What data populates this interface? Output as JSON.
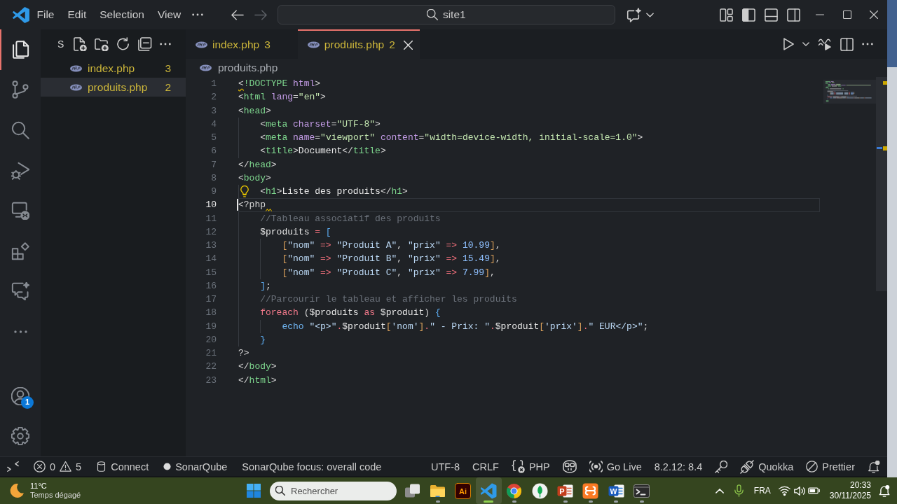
{
  "title_bar": {
    "menus": [
      "File",
      "Edit",
      "Selection",
      "View"
    ],
    "nav": [
      {
        "kind": "back",
        "disabled": false
      },
      {
        "kind": "forward",
        "disabled": true
      }
    ],
    "command_center": "site1",
    "layout_toggles": [
      {
        "kind": "primary-sidebar",
        "on": true
      },
      {
        "kind": "panel",
        "on": false
      },
      {
        "kind": "secondary-sidebar",
        "on": false
      }
    ]
  },
  "activity_bar": {
    "items": [
      {
        "kind": "explorer",
        "selected": true
      },
      {
        "kind": "source-control",
        "selected": false
      },
      {
        "kind": "search",
        "selected": false
      },
      {
        "kind": "run-debug",
        "selected": false
      },
      {
        "kind": "remote",
        "selected": false
      },
      {
        "kind": "extensions",
        "selected": false
      },
      {
        "kind": "chat",
        "selected": false
      }
    ],
    "accounts_badge": "1"
  },
  "sidebar": {
    "title": "S",
    "files": [
      {
        "name": "index.php",
        "problems": "3",
        "warning": true,
        "selected": false
      },
      {
        "name": "produits.php",
        "problems": "2",
        "warning": true,
        "selected": true
      }
    ]
  },
  "tabs": [
    {
      "name": "index.php",
      "problems": "3",
      "warning": true,
      "selected": false
    },
    {
      "name": "produits.php",
      "problems": "2",
      "warning": true,
      "selected": true
    }
  ],
  "breadcrumb": "produits.php",
  "editor": {
    "lines": [
      {
        "number": "1",
        "current": false,
        "lightbulb": false,
        "tokens": [
          {
            "kind": "warn",
            "text": "<"
          },
          {
            "kind": "tag",
            "text": "!DOCTYPE"
          },
          {
            "kind": "attr",
            "text": " html"
          },
          {
            "kind": "plain",
            "text": ">"
          }
        ]
      },
      {
        "number": "2",
        "current": false,
        "lightbulb": false,
        "tokens": [
          {
            "kind": "plain",
            "text": "<"
          },
          {
            "kind": "tag",
            "text": "html"
          },
          {
            "kind": "attr",
            "text": " lang"
          },
          {
            "kind": "plain",
            "text": "="
          },
          {
            "kind": "val",
            "text": "\"en\""
          },
          {
            "kind": "plain",
            "text": ">"
          }
        ]
      },
      {
        "number": "3",
        "current": false,
        "lightbulb": false,
        "tokens": [
          {
            "kind": "plain",
            "text": "<"
          },
          {
            "kind": "tag",
            "text": "head"
          },
          {
            "kind": "plain",
            "text": ">"
          }
        ]
      },
      {
        "number": "4",
        "current": false,
        "lightbulb": false,
        "tokens": [
          {
            "kind": "plain",
            "text": "    <"
          },
          {
            "kind": "tag",
            "text": "meta"
          },
          {
            "kind": "attr",
            "text": " charset"
          },
          {
            "kind": "plain",
            "text": "="
          },
          {
            "kind": "val",
            "text": "\"UTF-8\""
          },
          {
            "kind": "plain",
            "text": ">"
          }
        ]
      },
      {
        "number": "5",
        "current": false,
        "lightbulb": false,
        "tokens": [
          {
            "kind": "plain",
            "text": "    <"
          },
          {
            "kind": "tag",
            "text": "meta"
          },
          {
            "kind": "attr",
            "text": " name"
          },
          {
            "kind": "plain",
            "text": "="
          },
          {
            "kind": "val",
            "text": "\"viewport\""
          },
          {
            "kind": "attr",
            "text": " content"
          },
          {
            "kind": "plain",
            "text": "="
          },
          {
            "kind": "val",
            "text": "\"width=device-width, initial-scale=1.0\""
          },
          {
            "kind": "plain",
            "text": ">"
          }
        ]
      },
      {
        "number": "6",
        "current": false,
        "lightbulb": false,
        "tokens": [
          {
            "kind": "plain",
            "text": "    <"
          },
          {
            "kind": "tag",
            "text": "title"
          },
          {
            "kind": "plain",
            "text": ">"
          },
          {
            "kind": "text",
            "text": "Document"
          },
          {
            "kind": "plain",
            "text": "</"
          },
          {
            "kind": "tag",
            "text": "title"
          },
          {
            "kind": "plain",
            "text": ">"
          }
        ]
      },
      {
        "number": "7",
        "current": false,
        "lightbulb": false,
        "tokens": [
          {
            "kind": "plain",
            "text": "</"
          },
          {
            "kind": "tag",
            "text": "head"
          },
          {
            "kind": "plain",
            "text": ">"
          }
        ]
      },
      {
        "number": "8",
        "current": false,
        "lightbulb": false,
        "tokens": [
          {
            "kind": "plain",
            "text": "<"
          },
          {
            "kind": "tag",
            "text": "body"
          },
          {
            "kind": "plain",
            "text": ">"
          }
        ]
      },
      {
        "number": "9",
        "current": false,
        "lightbulb": true,
        "tokens": [
          {
            "kind": "plain",
            "text": "    <"
          },
          {
            "kind": "tag",
            "text": "h1"
          },
          {
            "kind": "plain",
            "text": ">"
          },
          {
            "kind": "text",
            "text": "Liste des produits"
          },
          {
            "kind": "plain",
            "text": "</"
          },
          {
            "kind": "tag",
            "text": "h1"
          },
          {
            "kind": "plain",
            "text": ">"
          }
        ]
      },
      {
        "number": "10",
        "current": true,
        "lightbulb": false,
        "tokens": [
          {
            "kind": "plain",
            "text": "<?php"
          },
          {
            "kind": "squiggle"
          }
        ]
      },
      {
        "number": "11",
        "current": false,
        "lightbulb": false,
        "tokens": [
          {
            "kind": "comment",
            "text": "    //Tableau associatif des produits"
          }
        ]
      },
      {
        "number": "12",
        "current": false,
        "lightbulb": false,
        "tokens": [
          {
            "kind": "var",
            "text": "    $produits"
          },
          {
            "kind": "op",
            "text": " ="
          },
          {
            "kind": "bracket",
            "text": " ["
          }
        ]
      },
      {
        "number": "13",
        "current": false,
        "lightbulb": false,
        "tokens": [
          {
            "kind": "bracket2",
            "text": "        ["
          },
          {
            "kind": "str",
            "text": "\"nom\""
          },
          {
            "kind": "op",
            "text": " =>"
          },
          {
            "kind": "str",
            "text": " \"Produit A\""
          },
          {
            "kind": "plain",
            "text": ","
          },
          {
            "kind": "str",
            "text": " \"prix\""
          },
          {
            "kind": "op",
            "text": " =>"
          },
          {
            "kind": "num",
            "text": " 10.99"
          },
          {
            "kind": "bracket2",
            "text": "]"
          },
          {
            "kind": "plain",
            "text": ","
          }
        ]
      },
      {
        "number": "14",
        "current": false,
        "lightbulb": false,
        "tokens": [
          {
            "kind": "bracket2",
            "text": "        ["
          },
          {
            "kind": "str",
            "text": "\"nom\""
          },
          {
            "kind": "op",
            "text": " =>"
          },
          {
            "kind": "str",
            "text": " \"Produit B\""
          },
          {
            "kind": "plain",
            "text": ","
          },
          {
            "kind": "str",
            "text": " \"prix\""
          },
          {
            "kind": "op",
            "text": " =>"
          },
          {
            "kind": "num",
            "text": " 15.49"
          },
          {
            "kind": "bracket2",
            "text": "]"
          },
          {
            "kind": "plain",
            "text": ","
          }
        ]
      },
      {
        "number": "15",
        "current": false,
        "lightbulb": false,
        "tokens": [
          {
            "kind": "bracket2",
            "text": "        ["
          },
          {
            "kind": "str",
            "text": "\"nom\""
          },
          {
            "kind": "op",
            "text": " =>"
          },
          {
            "kind": "str",
            "text": " \"Produit C\""
          },
          {
            "kind": "plain",
            "text": ","
          },
          {
            "kind": "str",
            "text": " \"prix\""
          },
          {
            "kind": "op",
            "text": " =>"
          },
          {
            "kind": "num",
            "text": " 7.99"
          },
          {
            "kind": "bracket2",
            "text": "]"
          },
          {
            "kind": "plain",
            "text": ","
          }
        ]
      },
      {
        "number": "16",
        "current": false,
        "lightbulb": false,
        "tokens": [
          {
            "kind": "bracket",
            "text": "    ]"
          },
          {
            "kind": "plain",
            "text": ";"
          }
        ]
      },
      {
        "number": "17",
        "current": false,
        "lightbulb": false,
        "tokens": [
          {
            "kind": "comment",
            "text": "    //Parcourir le tableau et afficher les produits"
          }
        ]
      },
      {
        "number": "18",
        "current": false,
        "lightbulb": false,
        "tokens": [
          {
            "kind": "kw",
            "text": "    foreach"
          },
          {
            "kind": "plain",
            "text": " ("
          },
          {
            "kind": "var",
            "text": "$produits"
          },
          {
            "kind": "kw",
            "text": " as"
          },
          {
            "kind": "var",
            "text": " $produit"
          },
          {
            "kind": "plain",
            "text": ")"
          },
          {
            "kind": "bracket",
            "text": " {"
          }
        ]
      },
      {
        "number": "19",
        "current": false,
        "lightbulb": false,
        "tokens": [
          {
            "kind": "fn",
            "text": "        echo"
          },
          {
            "kind": "str",
            "text": " \"<p>\""
          },
          {
            "kind": "op",
            "text": "."
          },
          {
            "kind": "var",
            "text": "$produit"
          },
          {
            "kind": "bracket2",
            "text": "["
          },
          {
            "kind": "str",
            "text": "'nom'"
          },
          {
            "kind": "bracket2",
            "text": "]"
          },
          {
            "kind": "op",
            "text": "."
          },
          {
            "kind": "str",
            "text": "\" - Prix: \""
          },
          {
            "kind": "op",
            "text": "."
          },
          {
            "kind": "var",
            "text": "$produit"
          },
          {
            "kind": "bracket2",
            "text": "["
          },
          {
            "kind": "str",
            "text": "'prix'"
          },
          {
            "kind": "bracket2",
            "text": "]"
          },
          {
            "kind": "op",
            "text": "."
          },
          {
            "kind": "str",
            "text": "\" EUR</p>\""
          },
          {
            "kind": "plain",
            "text": ";"
          }
        ]
      },
      {
        "number": "20",
        "current": false,
        "lightbulb": false,
        "tokens": [
          {
            "kind": "bracket",
            "text": "    }"
          }
        ]
      },
      {
        "number": "21",
        "current": false,
        "lightbulb": false,
        "tokens": [
          {
            "kind": "plain",
            "text": "?>"
          }
        ]
      },
      {
        "number": "22",
        "current": false,
        "lightbulb": false,
        "tokens": [
          {
            "kind": "plain",
            "text": "</"
          },
          {
            "kind": "tag",
            "text": "body"
          },
          {
            "kind": "plain",
            "text": ">"
          }
        ]
      },
      {
        "number": "23",
        "current": false,
        "lightbulb": false,
        "tokens": [
          {
            "kind": "plain",
            "text": "</"
          },
          {
            "kind": "tag",
            "text": "html"
          },
          {
            "kind": "plain",
            "text": ">"
          }
        ]
      }
    ]
  },
  "status_bar": {
    "left": [
      {
        "kind": "remote"
      },
      {
        "kind": "problems",
        "errors": "0",
        "warnings": "5"
      },
      {
        "kind": "database",
        "label": "Connect"
      },
      {
        "kind": "dot",
        "label": "SonarQube"
      },
      {
        "kind": "text",
        "label": "SonarQube focus: overall code"
      }
    ],
    "right": [
      {
        "kind": "text",
        "label": "UTF-8"
      },
      {
        "kind": "text",
        "label": "CRLF"
      },
      {
        "kind": "braces",
        "label": "PHP"
      },
      {
        "kind": "robot"
      },
      {
        "kind": "broadcast",
        "label": "Go Live"
      },
      {
        "kind": "text",
        "label": "8.2.12: 8.4"
      },
      {
        "kind": "key"
      },
      {
        "kind": "plug",
        "label": "Quokka"
      },
      {
        "kind": "prohibited",
        "label": "Prettier"
      },
      {
        "kind": "bell"
      }
    ]
  },
  "taskbar": {
    "weather": {
      "temperature": "11°C",
      "condition": "Temps dégagé"
    },
    "search": {
      "placeholder": "Rechercher"
    },
    "apps": [
      {
        "kind": "task-view",
        "running": false,
        "selected": false
      },
      {
        "kind": "folder",
        "running": true,
        "selected": false
      },
      {
        "kind": "ai",
        "glyph": "Ai",
        "running": false,
        "selected": false
      },
      {
        "kind": "code",
        "running": true,
        "selected": true
      },
      {
        "kind": "browser",
        "running": true,
        "selected": false
      },
      {
        "kind": "leaf",
        "running": false,
        "selected": false
      },
      {
        "kind": "slides",
        "glyph": "P",
        "running": true,
        "selected": false
      },
      {
        "kind": "knot",
        "running": true,
        "selected": false
      },
      {
        "kind": "document",
        "glyph": "W",
        "running": true,
        "selected": false
      },
      {
        "kind": "terminal",
        "running": true,
        "selected": false
      }
    ],
    "tray": {
      "language": "FRA",
      "time": "20:33",
      "date": "30/11/2025"
    }
  }
}
